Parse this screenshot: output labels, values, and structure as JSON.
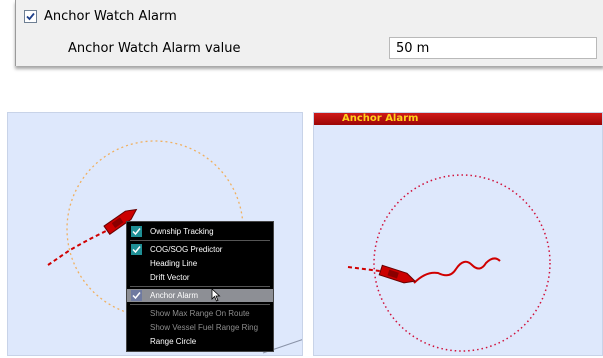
{
  "settings": {
    "checkbox_label": "Anchor Watch Alarm",
    "checkbox_checked": true,
    "value_label": "Anchor Watch Alarm value",
    "value": "50 m"
  },
  "left_chart": {
    "context_menu": {
      "items": [
        {
          "label": "Ownship Tracking",
          "checked": true,
          "enabled": true
        },
        {
          "label": "COG/SOG Predictor",
          "checked": true,
          "enabled": true
        },
        {
          "label": "Heading Line",
          "checked": false,
          "enabled": true
        },
        {
          "label": "Drift Vector",
          "checked": false,
          "enabled": true
        },
        {
          "label": "Anchor Alarm",
          "checked": true,
          "enabled": true,
          "highlighted": true
        },
        {
          "label": "Show Max Range On Route",
          "checked": false,
          "enabled": false
        },
        {
          "label": "Show Vessel Fuel Range Ring",
          "checked": false,
          "enabled": false
        },
        {
          "label": "Range Circle",
          "checked": false,
          "enabled": true
        }
      ]
    }
  },
  "right_chart": {
    "alarm_title": "Anchor Alarm"
  },
  "colors": {
    "chart_water": "#dee8fc",
    "alarm_red": "#c00000",
    "alarm_text": "#ffd21a",
    "anchor_circle_normal": "#f0b060",
    "anchor_circle_alarm": "#d0103a",
    "vessel": "#cc0000",
    "menu_check": "#1f8f95"
  },
  "icons": [
    "checkmark-icon",
    "vessel-icon",
    "mouse-cursor-icon"
  ]
}
